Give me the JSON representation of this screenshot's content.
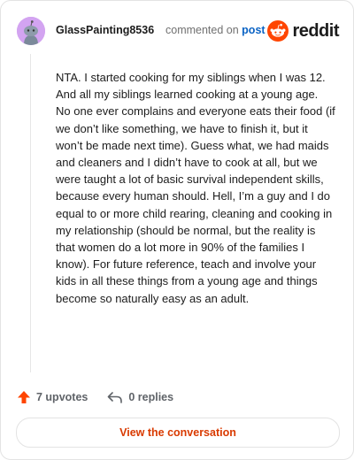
{
  "comment": {
    "username": "GlassPainting8536",
    "meta_prefix": "commented on",
    "meta_link": "post",
    "body": "NTA. I started cooking for my siblings when I was 12. And all my siblings learned cooking at a young age. No one ever complains and everyone eats their food (if we don’t like something, we have to finish it, but it won’t be made next time). Guess what, we had maids and cleaners and I didn’t have to cook at all, but we were taught a lot of basic survival independent skills, because every human should. Hell, I’m a guy and I do equal to or more child rearing, cleaning and cooking in my relationship (should be normal, but the reality is that women do a lot more in 90% of the families I know). For future reference, teach and involve your kids in all these things from a young age and things become so naturally easy as an adult."
  },
  "brand": {
    "name": "reddit",
    "color": "#ff4500"
  },
  "actions": {
    "upvotes": "7 upvotes",
    "replies": "0 replies"
  },
  "cta": {
    "label": "View the conversation"
  },
  "colors": {
    "accent": "#d93a00",
    "link": "#0b63c4",
    "upvote": "#ff4500"
  }
}
